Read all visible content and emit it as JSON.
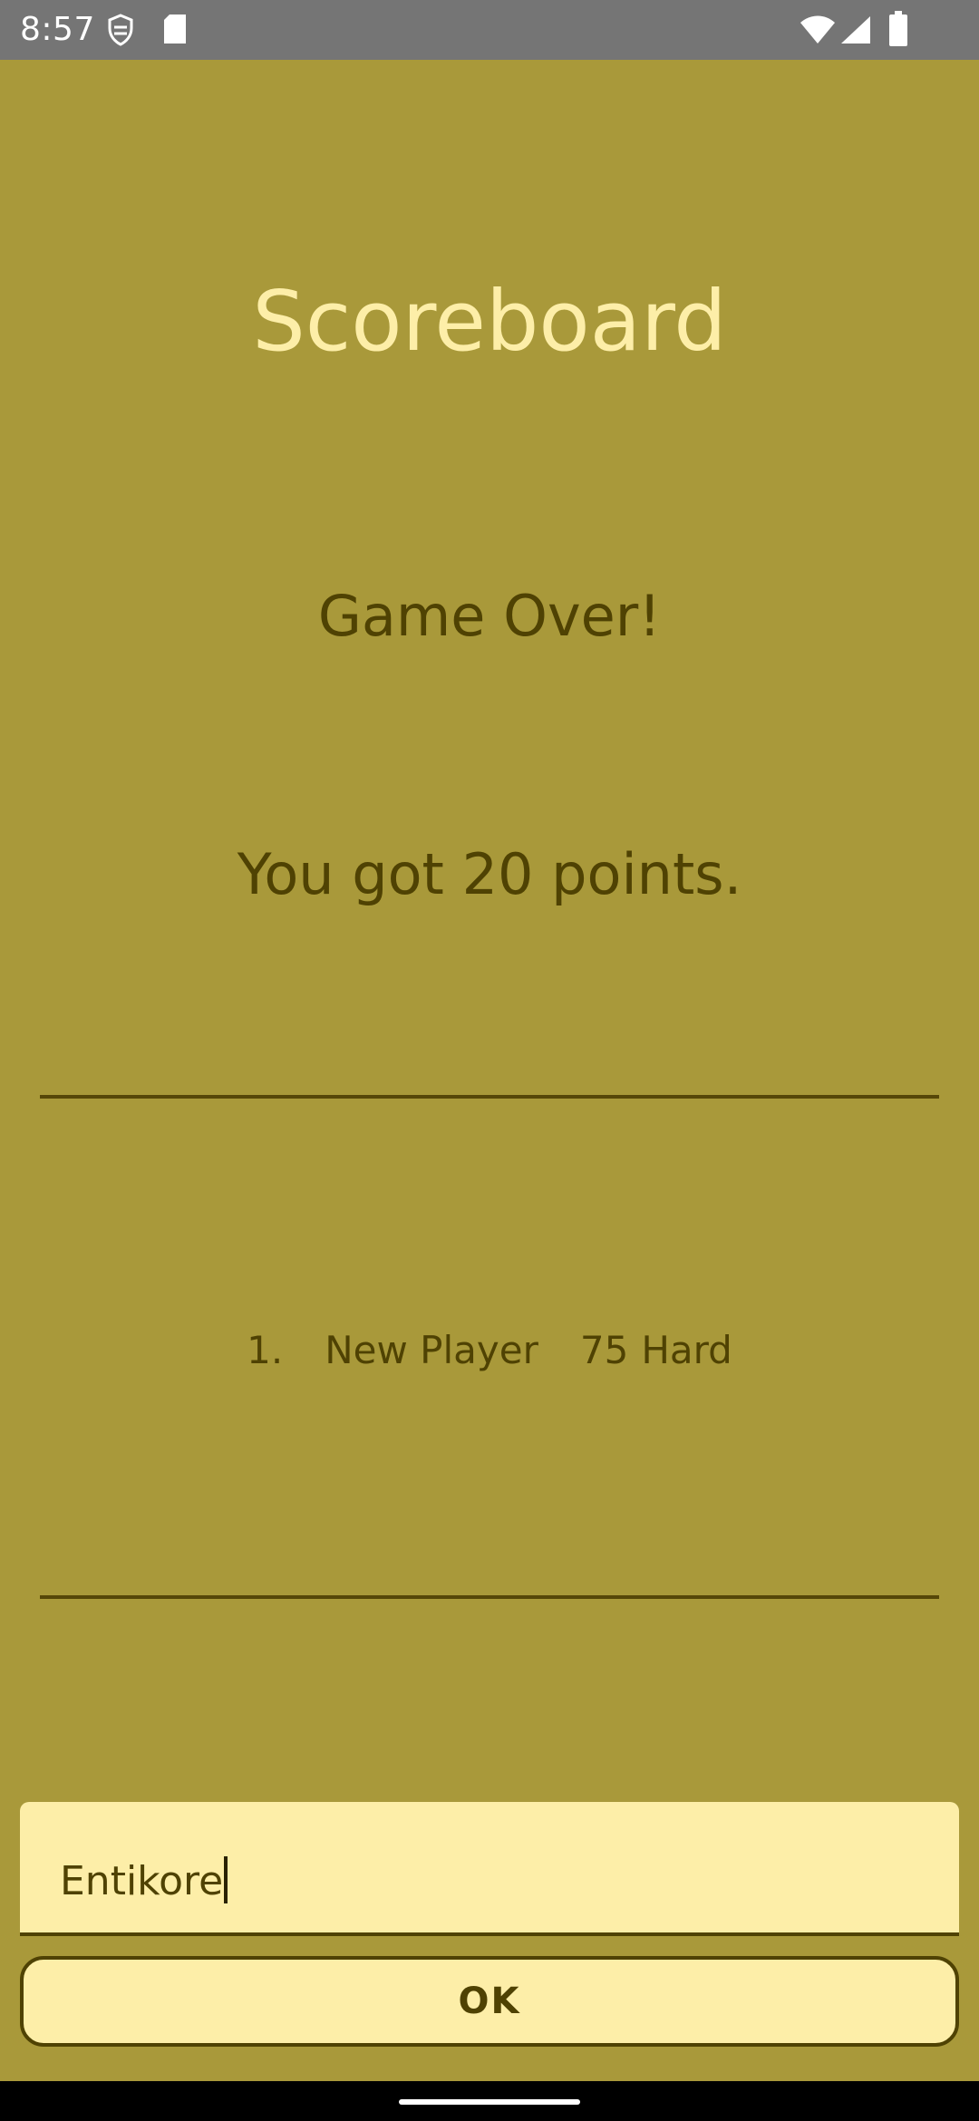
{
  "status_bar": {
    "time": "8:57",
    "icons": [
      "shield-notification-icon",
      "sd-card-icon",
      "wifi-icon",
      "cellular-signal-icon",
      "battery-icon"
    ]
  },
  "screen": {
    "title": "Scoreboard",
    "game_over": "Game Over!",
    "points_text": "You got 20 points."
  },
  "scores": [
    {
      "rank": "1.",
      "name": "New Player",
      "points": "75",
      "difficulty": "Hard"
    }
  ],
  "name_input": {
    "value": "Entikore"
  },
  "ok_button": {
    "label": "OK"
  },
  "colors": {
    "background": "#a9993a",
    "title": "#fdeea8",
    "text": "#4f4203",
    "field_bg": "#fdeea8"
  }
}
